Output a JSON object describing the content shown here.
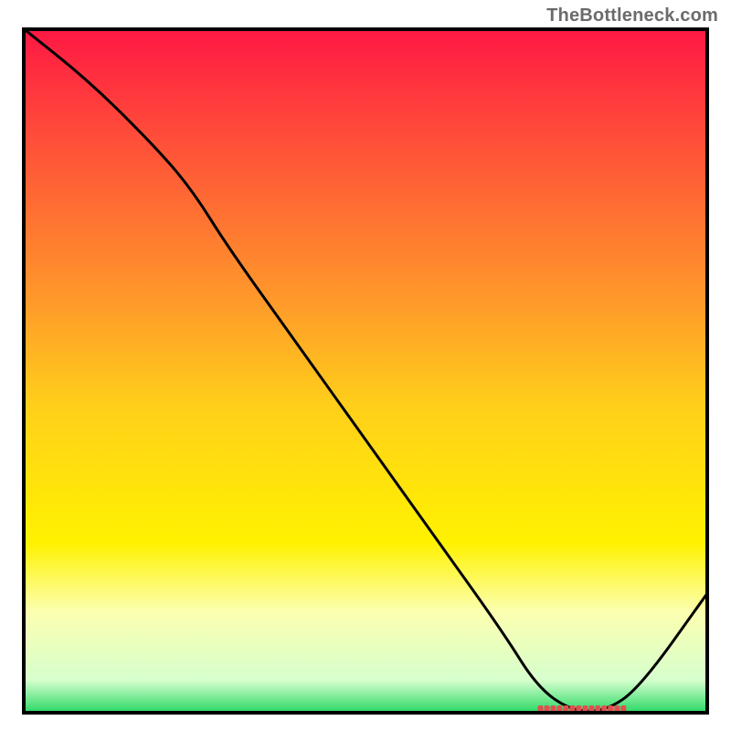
{
  "watermark": "TheBottleneck.com",
  "chart_data": {
    "type": "line",
    "title": "",
    "xlabel": "",
    "ylabel": "",
    "xlim": [
      0,
      100
    ],
    "ylim": [
      0,
      100
    ],
    "grid": false,
    "legend": false,
    "series": [
      {
        "name": "bottleneck-curve",
        "x": [
          0,
          10,
          20,
          25,
          30,
          40,
          50,
          60,
          70,
          75,
          80,
          85,
          90,
          100
        ],
        "values": [
          100,
          92,
          82,
          76,
          68,
          54,
          40,
          26,
          12,
          4,
          0.5,
          0.5,
          4,
          18
        ]
      }
    ],
    "colors": {
      "line": "#000000",
      "optimal_marker": "#e05050",
      "gradient_stops": [
        {
          "y": 100,
          "color": "#ff1744"
        },
        {
          "y": 85,
          "color": "#ff4a3a"
        },
        {
          "y": 60,
          "color": "#ff9a2a"
        },
        {
          "y": 45,
          "color": "#ffcf1a"
        },
        {
          "y": 25,
          "color": "#fff200"
        },
        {
          "y": 15,
          "color": "#fcffb0"
        },
        {
          "y": 5,
          "color": "#d6ffcd"
        },
        {
          "y": 0,
          "color": "#1fd65f"
        }
      ]
    },
    "annotations": [
      {
        "name": "optimal-region-marker",
        "x_start": 75,
        "x_end": 88,
        "y": 0.8
      }
    ]
  }
}
